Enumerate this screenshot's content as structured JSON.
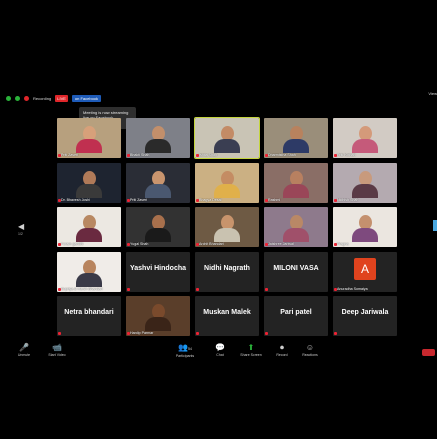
{
  "topbar": {
    "recording_label": "Recording",
    "live_label": "LIVE",
    "facebook_label": "on Facebook",
    "view_label": "View"
  },
  "tooltip": {
    "text": "Meeting is now streaming live on Facebook"
  },
  "gallery": {
    "tiles": [
      {
        "name": "Priti Zaveri",
        "kind": "video",
        "bg": "#b7a07e",
        "skin": "#d7a07a",
        "shirt": "#c03050",
        "active": false
      },
      {
        "name": "Bhakti Shah",
        "kind": "video",
        "bg": "#7e8088",
        "skin": "#c28f6b",
        "shirt": "#2a2a2a",
        "active": false
      },
      {
        "name": "Ishita Shah",
        "kind": "video",
        "bg": "#c9c4b5",
        "skin": "#c38b66",
        "shirt": "#3a3e52",
        "active": true
      },
      {
        "name": "Dharmistha Shah",
        "kind": "video",
        "bg": "#9a8e7a",
        "skin": "#b8825e",
        "shirt": "#2d3a66",
        "active": false
      },
      {
        "name": "Priti Kothari",
        "kind": "video",
        "bg": "#d2cbc4",
        "skin": "#d49a7a",
        "shirt": "#c55a7a",
        "active": false
      },
      {
        "name": "Dr. Bhavesh Joshi",
        "kind": "video",
        "bg": "#1e2430",
        "skin": "#b07a58",
        "shirt": "#3a3a3a",
        "active": false
      },
      {
        "name": "Priti Zaveri",
        "kind": "video",
        "bg": "#2a2d36",
        "skin": "#c9956e",
        "shirt": "#4a5870",
        "active": false
      },
      {
        "name": "Bhagya Desai",
        "kind": "video",
        "bg": "#cbb083",
        "skin": "#c48c63",
        "shirt": "#e0b04a",
        "active": false
      },
      {
        "name": "Rashmi",
        "kind": "video",
        "bg": "#8a6e66",
        "skin": "#b88060",
        "shirt": "#9a4658",
        "active": false
      },
      {
        "name": "Nidhish Shah",
        "kind": "video",
        "bg": "#b4aab0",
        "skin": "#c89a7c",
        "shirt": "#5a3a46",
        "active": false
      },
      {
        "name": "Foram gandhi",
        "kind": "video",
        "bg": "#ece8e2",
        "skin": "#b88862",
        "shirt": "#6a2a40",
        "active": false
      },
      {
        "name": "Yugal Shah",
        "kind": "video",
        "bg": "#323232",
        "skin": "#a8704c",
        "shirt": "#1a1a1a",
        "active": false
      },
      {
        "name": "Archit Bhandari",
        "kind": "video",
        "bg": "#6e5a44",
        "skin": "#c8946c",
        "shirt": "#c9c2b0",
        "active": false
      },
      {
        "name": "Jaishree Jariwal",
        "kind": "video",
        "bg": "#8e7a8c",
        "skin": "#b98866",
        "shirt": "#a0506a",
        "active": false
      },
      {
        "name": "Pragna",
        "kind": "video",
        "bg": "#ebe6e0",
        "skin": "#c4906e",
        "shirt": "#7e4a7e",
        "active": false
      },
      {
        "name": "Supriya & Harsh Bhandari",
        "kind": "video",
        "bg": "#f0ece8",
        "skin": "#b8845e",
        "shirt": "#3a3a48",
        "active": false
      },
      {
        "name": "Yashvi Hindocha",
        "kind": "text",
        "active": false
      },
      {
        "name": "Nidhi Nagrath",
        "kind": "text",
        "active": false
      },
      {
        "name": "MILONI VASA",
        "kind": "text",
        "active": false
      },
      {
        "name": "Anuradha Somaiya",
        "kind": "avatar",
        "letter": "A",
        "active": false
      },
      {
        "name": "Netra bhandari",
        "kind": "text",
        "active": false
      },
      {
        "name": "Hardip Parmar",
        "kind": "video",
        "bg": "#5a3e2a",
        "skin": "#7a4a2c",
        "shirt": "#3a2418",
        "active": false
      },
      {
        "name": "Muskan Malek",
        "kind": "text",
        "active": false
      },
      {
        "name": "Pari patel",
        "kind": "text",
        "active": false
      },
      {
        "name": "Deep Jariwala",
        "kind": "text",
        "active": false
      }
    ]
  },
  "nav": {
    "left_arrow": "◀",
    "page_indicator": "1/2"
  },
  "toolbar": {
    "unmute": {
      "label": "Unmute",
      "icon": "🎤"
    },
    "start_video": {
      "label": "Start Video",
      "icon": "📹"
    },
    "participants": {
      "label": "Participants",
      "icon": "👥",
      "count": "54"
    },
    "chat": {
      "label": "Chat",
      "icon": "💬"
    },
    "share_screen": {
      "label": "Share Screen",
      "icon": "⬆"
    },
    "record": {
      "label": "Record",
      "icon": "⏺"
    },
    "reactions": {
      "label": "Reactions",
      "icon": "☺"
    }
  },
  "colors": {
    "accent_green": "#2ab23a",
    "leave_red": "#c8282e",
    "active_speaker": "#c4d53e"
  }
}
